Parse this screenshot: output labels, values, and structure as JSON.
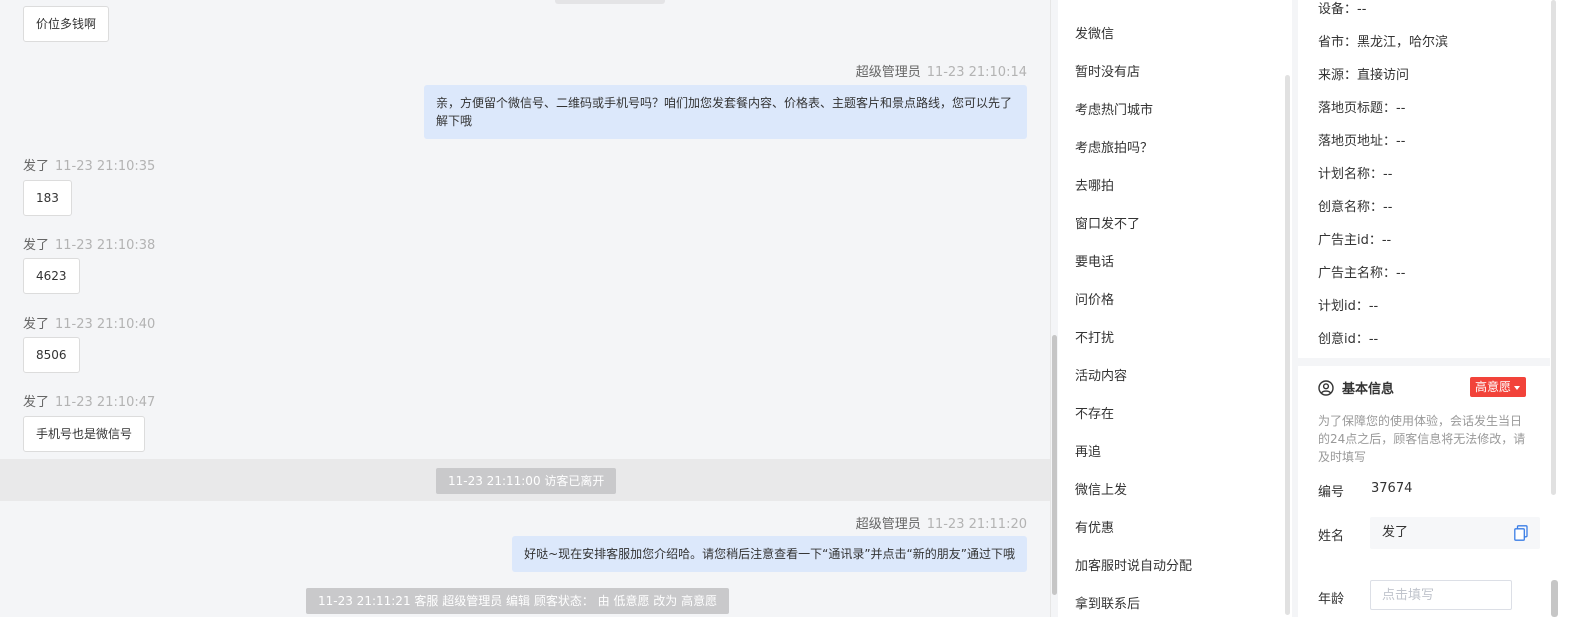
{
  "chat": {
    "first_message": "价位多钱啊",
    "agent_msg1": {
      "sender": "超级管理员",
      "time": "11-23 21:10:14",
      "text": "亲，方便留个微信号、二维码或手机号吗？咱们加您发套餐内容、价格表、主题客片和景点路线，您可以先了解下哦"
    },
    "visitor_msgs": [
      {
        "sender": "发了",
        "time": "11-23 21:10:35",
        "text": "183"
      },
      {
        "sender": "发了",
        "time": "11-23 21:10:38",
        "text": "4623"
      },
      {
        "sender": "发了",
        "time": "11-23 21:10:40",
        "text": "8506"
      },
      {
        "sender": "发了",
        "time": "11-23 21:10:47",
        "text": "手机号也是微信号"
      }
    ],
    "left_notice": "11-23 21:11:00 访客已离开",
    "agent_msg2": {
      "sender": "超级管理员",
      "time": "11-23 21:11:20",
      "text": "好哒~现在安排客服加您介绍哈。请您稍后注意查看一下“通讯录”并点击“新的朋友”通过下哦"
    },
    "status_notice": "11-23 21:11:21 客服 超级管理员 编辑 顾客状态： 由 低意愿 改为 高意愿"
  },
  "quick_replies": [
    "发微信",
    "暂时没有店",
    "考虑热门城市",
    "考虑旅拍吗？",
    "去哪拍",
    "窗口发不了",
    "要电话",
    "问价格",
    "不打扰",
    "活动内容",
    "不存在",
    "再追",
    "微信上发",
    "有优惠",
    "加客服时说自动分配",
    "拿到联系后"
  ],
  "visitor_info": {
    "rows": [
      "设备：--",
      "省市：黑龙江，哈尔滨",
      "来源：直接访问",
      "落地页标题：--",
      "落地页地址：--",
      "计划名称：--",
      "创意名称：--",
      "广告主id：--",
      "广告主名称：--",
      "计划id：--",
      "创意id：--"
    ]
  },
  "basic_info": {
    "title": "基本信息",
    "intent_badge": "高意愿",
    "notice": "为了保障您的使用体验，会话发生当日的24点之后，顾客信息将无法修改，请及时填写",
    "id_label": "编号",
    "id_value": "37674",
    "name_label": "姓名",
    "name_value": "发了",
    "age_label": "年龄",
    "age_placeholder": "点击填写"
  },
  "colors": {
    "agent_bubble": "#dce8fb",
    "badge": "#f2433a",
    "chat_bg": "#f4f5f7"
  }
}
